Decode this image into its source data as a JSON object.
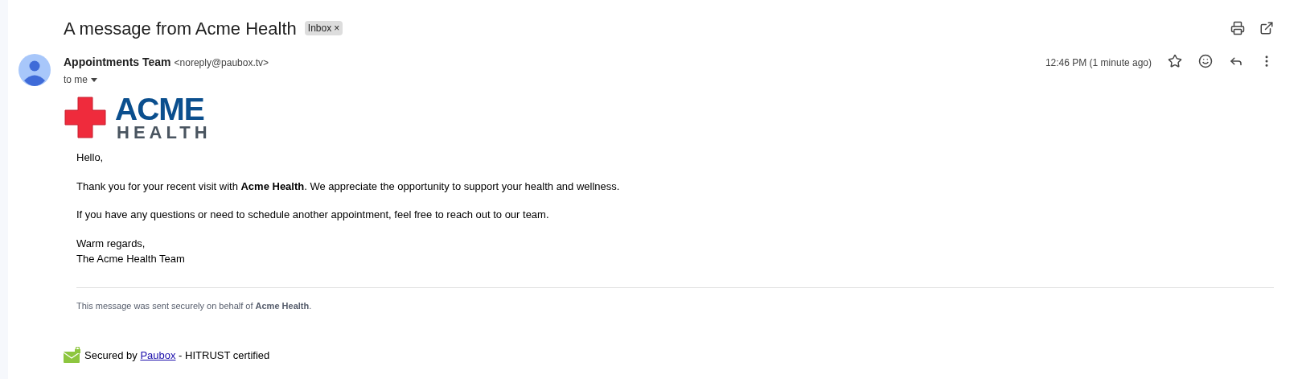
{
  "subject": "A message from Acme Health",
  "label": {
    "text": "Inbox",
    "remove": "×"
  },
  "sender": {
    "name": "Appointments Team",
    "email": "<noreply@paubox.tv>",
    "recipient": "to me"
  },
  "time": "12:46 PM (1 minute ago)",
  "starred": false,
  "logo": {
    "top": "ACME",
    "bottom": "HEALTH"
  },
  "body": [
    "Hello,",
    "Thank you for your recent visit with **Acme Health**. We appreciate the opportunity to support your health and wellness.",
    "If you have any questions or need to schedule another appointment, feel free to reach out to our team."
  ],
  "signoff": [
    "Warm regards,",
    "The Acme Health Team"
  ],
  "footer_note": "This message was sent securely on behalf of **Acme Health**.",
  "secured": {
    "before": "Secured by",
    "link": "Paubox",
    "after": "- HITRUST certified"
  }
}
